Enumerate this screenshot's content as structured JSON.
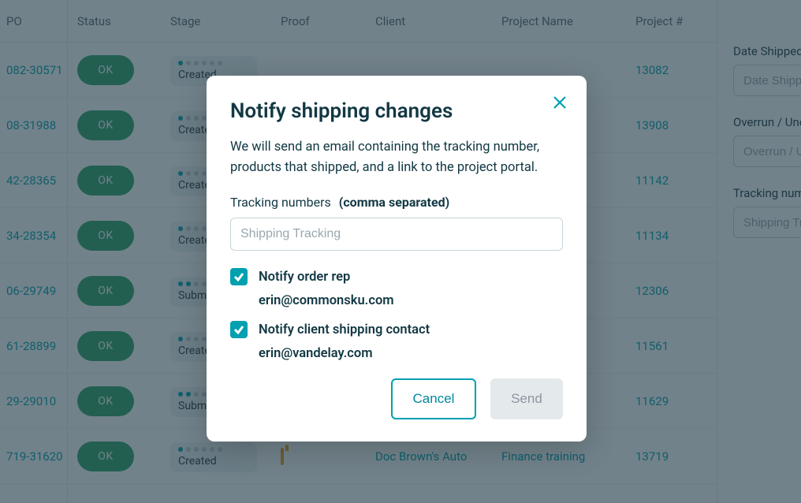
{
  "table": {
    "headers": {
      "po": "PO",
      "status": "Status",
      "stage": "Stage",
      "proof": "Proof",
      "client": "Client",
      "project_name": "Project Name",
      "project_num": "Project #"
    },
    "rows": [
      {
        "po": "082-30571",
        "status": "OK",
        "stage": "Created",
        "dots_on": 1,
        "client": "",
        "pname": "",
        "pnum": "13082"
      },
      {
        "po": "08-31988",
        "status": "OK",
        "stage": "Created",
        "dots_on": 1,
        "client": "",
        "pname": "",
        "pnum": "13908"
      },
      {
        "po": "42-28365",
        "status": "OK",
        "stage": "Created",
        "dots_on": 1,
        "client": "",
        "pname": "",
        "pnum": "11142"
      },
      {
        "po": "34-28354",
        "status": "OK",
        "stage": "Created",
        "dots_on": 1,
        "client": "",
        "pname": "",
        "pnum": "11134"
      },
      {
        "po": "06-29749",
        "status": "OK",
        "stage": "Submitted",
        "dots_on": 2,
        "client": "",
        "pname": "",
        "pnum": "12306"
      },
      {
        "po": "61-28899",
        "status": "OK",
        "stage": "Created",
        "dots_on": 1,
        "client": "",
        "pname": "",
        "pnum": "11561"
      },
      {
        "po": "29-29010",
        "status": "OK",
        "stage": "Submitted",
        "dots_on": 2,
        "client": "",
        "pname": "",
        "pnum": "11629"
      },
      {
        "po": "719-31620",
        "status": "OK",
        "stage": "Created",
        "dots_on": 1,
        "client": "Doc Brown's Auto",
        "pname": "Finance training",
        "pnum": "13719"
      }
    ]
  },
  "side": {
    "date_shipped_label": "Date Shipped",
    "date_shipped_placeholder": "Date Shipped",
    "overrun_label": "Overrun / Underrun",
    "overrun_placeholder": "Overrun / Underrun",
    "tracking_label": "Tracking number",
    "tracking_placeholder": "Shipping Tracking"
  },
  "modal": {
    "title": "Notify shipping changes",
    "body": "We will send an email containing the tracking number, products that shipped, and a link to the project portal.",
    "tracking_label": "Tracking numbers",
    "tracking_hint": "(comma separated)",
    "tracking_placeholder": "Shipping Tracking",
    "notify_rep_label": "Notify order rep",
    "notify_rep_email": "erin@commonsku.com",
    "notify_client_label": "Notify client shipping contact",
    "notify_client_email": "erin@vandelay.com",
    "cancel": "Cancel",
    "send": "Send"
  }
}
